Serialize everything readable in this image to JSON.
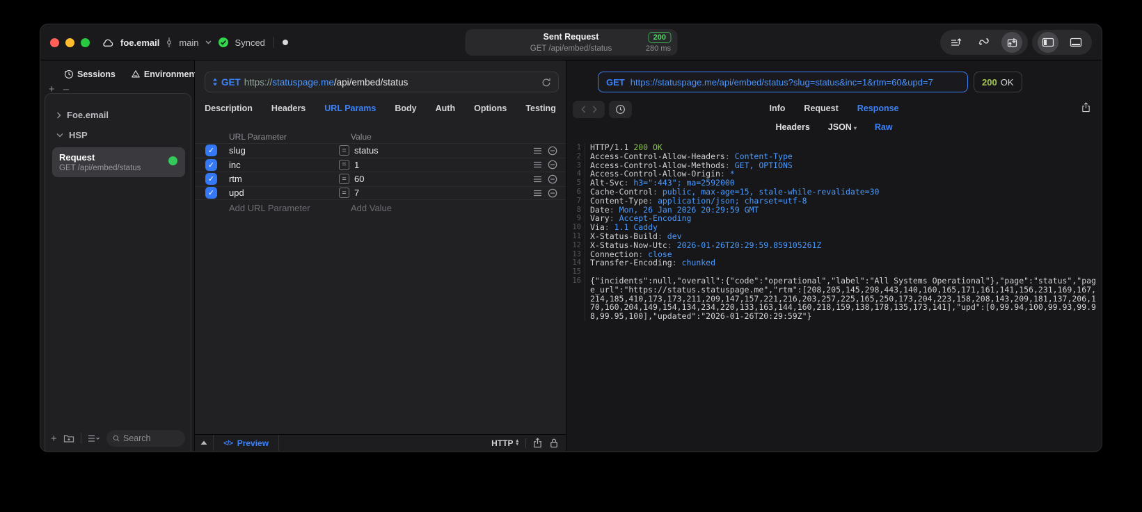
{
  "titlebar": {
    "project": "foe.email",
    "branch": "main",
    "sync_status": "Synced",
    "request_title": "Sent Request",
    "request_subtitle": "GET /api/embed/status",
    "status_code": "200",
    "duration": "280 ms"
  },
  "sidebar": {
    "tabs": [
      {
        "label": "Sessions"
      },
      {
        "label": "Environments"
      }
    ],
    "tree": [
      {
        "label": "Foe.email"
      },
      {
        "label": "HSP"
      }
    ],
    "request_item": {
      "title": "Request",
      "subtitle": "GET /api/embed/status"
    },
    "search_placeholder": "Search"
  },
  "request_panel": {
    "method": "GET",
    "url_scheme": "https://",
    "url_host": "statuspage.me",
    "url_path": "/api/embed/status",
    "tabs": [
      "Description",
      "Headers",
      "URL Params",
      "Body",
      "Auth",
      "Options",
      "Testing"
    ],
    "active_tab": "URL Params",
    "table": {
      "columns": [
        "URL Parameter",
        "Value"
      ],
      "rows": [
        {
          "checked": true,
          "name": "slug",
          "value": "status"
        },
        {
          "checked": true,
          "name": "inc",
          "value": "1"
        },
        {
          "checked": true,
          "name": "rtm",
          "value": "60"
        },
        {
          "checked": true,
          "name": "upd",
          "value": "7"
        }
      ],
      "add_name_placeholder": "Add URL Parameter",
      "add_value_placeholder": "Add Value"
    },
    "footer": {
      "preview_label": "Preview",
      "code_glyph": "</>",
      "protocol": "HTTP"
    }
  },
  "response_panel": {
    "method": "GET",
    "url": "https://statuspage.me/api/embed/status?slug=status&inc=1&rtm=60&upd=7",
    "status_code": "200",
    "status_text": "OK",
    "tabs": [
      "Info",
      "Request",
      "Response"
    ],
    "active_tab": "Response",
    "subtabs": [
      "Headers",
      "JSON",
      "Raw"
    ],
    "active_subtab": "Raw",
    "lines": [
      {
        "n": "1",
        "segs": [
          [
            "HTTP/1.1 ",
            "p"
          ],
          [
            "200 OK",
            "g"
          ]
        ]
      },
      {
        "n": "2",
        "segs": [
          [
            "Access-Control-Allow-Headers",
            "p"
          ],
          [
            ": ",
            "d"
          ],
          [
            "Content-Type",
            "b"
          ]
        ]
      },
      {
        "n": "3",
        "segs": [
          [
            "Access-Control-Allow-Methods",
            "p"
          ],
          [
            ": ",
            "d"
          ],
          [
            "GET, OPTIONS",
            "b"
          ]
        ]
      },
      {
        "n": "4",
        "segs": [
          [
            "Access-Control-Allow-Origin",
            "p"
          ],
          [
            ": ",
            "d"
          ],
          [
            "*",
            "b"
          ]
        ]
      },
      {
        "n": "5",
        "segs": [
          [
            "Alt-Svc",
            "p"
          ],
          [
            ": ",
            "d"
          ],
          [
            "h3=\":443\"; ma=2592000",
            "b"
          ]
        ]
      },
      {
        "n": "6",
        "segs": [
          [
            "Cache-Control",
            "p"
          ],
          [
            ": ",
            "d"
          ],
          [
            "public, max-age=15, stale-while-revalidate=30",
            "b"
          ]
        ]
      },
      {
        "n": "7",
        "segs": [
          [
            "Content-Type",
            "p"
          ],
          [
            ": ",
            "d"
          ],
          [
            "application/json; charset=utf-8",
            "b"
          ]
        ]
      },
      {
        "n": "8",
        "segs": [
          [
            "Date",
            "p"
          ],
          [
            ": ",
            "d"
          ],
          [
            "Mon, 26 Jan 2026 20:29:59 GMT",
            "b"
          ]
        ]
      },
      {
        "n": "9",
        "segs": [
          [
            "Vary",
            "p"
          ],
          [
            ": ",
            "d"
          ],
          [
            "Accept-Encoding",
            "b"
          ]
        ]
      },
      {
        "n": "10",
        "segs": [
          [
            "Via",
            "p"
          ],
          [
            ": ",
            "d"
          ],
          [
            "1.1 Caddy",
            "b"
          ]
        ]
      },
      {
        "n": "11",
        "segs": [
          [
            "X-Status-Build",
            "p"
          ],
          [
            ": ",
            "d"
          ],
          [
            "dev",
            "b"
          ]
        ]
      },
      {
        "n": "12",
        "segs": [
          [
            "X-Status-Now-Utc",
            "p"
          ],
          [
            ": ",
            "d"
          ],
          [
            "2026-01-26T20:29:59.859105261Z",
            "b"
          ]
        ]
      },
      {
        "n": "13",
        "segs": [
          [
            "Connection",
            "p"
          ],
          [
            ": ",
            "d"
          ],
          [
            "close",
            "b"
          ]
        ]
      },
      {
        "n": "14",
        "segs": [
          [
            "Transfer-Encoding",
            "p"
          ],
          [
            ": ",
            "d"
          ],
          [
            "chunked",
            "b"
          ]
        ]
      },
      {
        "n": "15",
        "segs": []
      },
      {
        "n": "16",
        "segs": [
          [
            "{\"incidents\":null,\"overall\":{\"code\":\"operational\",\"label\":\"All Systems Operational\"},\"page\":\"status\",\"page_url\":\"https://status.statuspage.me\",\"rtm\":[208,205,145,298,443,140,160,165,171,161,141,156,231,169,167,214,185,410,173,173,211,209,147,157,221,216,203,257,225,165,250,173,204,223,158,208,143,209,181,137,206,170,160,204,149,154,134,234,220,133,163,144,160,218,159,138,178,135,173,141],\"upd\":[0,99.94,100,99.93,99.98,99.95,100],\"updated\":\"2026-01-26T20:29:59Z\"}",
            "p"
          ]
        ]
      }
    ]
  },
  "colors": {
    "accent_blue": "#3d82f7",
    "status_green": "#4cd964",
    "checkbox_blue": "#3478f6"
  }
}
